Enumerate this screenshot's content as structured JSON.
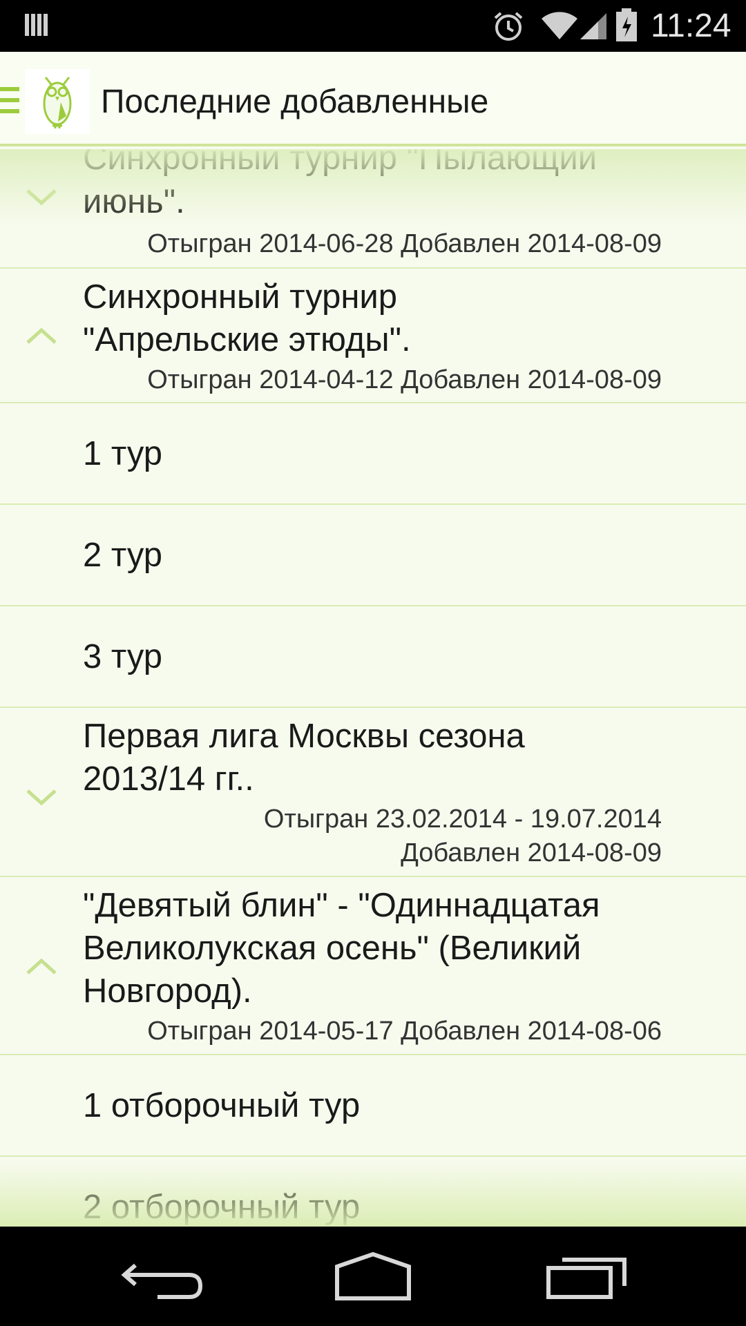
{
  "status_bar": {
    "time": "11:24",
    "icons": [
      "notification-icon",
      "alarm-icon",
      "wifi-icon",
      "signal-icon",
      "battery-icon"
    ]
  },
  "action_bar": {
    "title": "Последние добавленные",
    "logo": "owl-logo",
    "drawer_icon": "drawer-menu-icon"
  },
  "list": {
    "rows": [
      {
        "type": "group",
        "expanded": false,
        "title_lines": [
          "Синхронный турнир \"Пылающий",
          "июнь\"."
        ],
        "meta_lines": [
          "Отыгран 2014-06-28 Добавлен 2014-08-09"
        ]
      },
      {
        "type": "group",
        "expanded": true,
        "title_lines": [
          "Синхронный турнир",
          "\"Апрельские этюды\"."
        ],
        "meta_lines": [
          "Отыгран 2014-04-12 Добавлен 2014-08-09"
        ]
      },
      {
        "type": "child",
        "label": "1 тур"
      },
      {
        "type": "child",
        "label": "2 тур"
      },
      {
        "type": "child",
        "label": "3 тур"
      },
      {
        "type": "group",
        "expanded": false,
        "title_lines": [
          "Первая лига Москвы сезона",
          "2013/14 гг.."
        ],
        "meta_lines": [
          "Отыгран 23.02.2014 - 19.07.2014",
          "Добавлен 2014-08-09"
        ]
      },
      {
        "type": "group",
        "expanded": true,
        "title_lines": [
          "\"Девятый блин\" - \"Одиннадцатая",
          "Великолукская осень\" (Великий",
          "Новгород)."
        ],
        "meta_lines": [
          "Отыгран 2014-05-17 Добавлен 2014-08-06"
        ]
      },
      {
        "type": "child",
        "label": "1 отборочный тур"
      },
      {
        "type": "child",
        "label": "2 отборочный тур"
      }
    ]
  },
  "nav_bar": {
    "buttons": [
      "back-icon",
      "home-icon",
      "recents-icon"
    ]
  },
  "colors": {
    "accent": "#9ccc3c",
    "chevron": "#c6e08e",
    "divider": "#d9ecb4",
    "background": "#f7fbee"
  }
}
